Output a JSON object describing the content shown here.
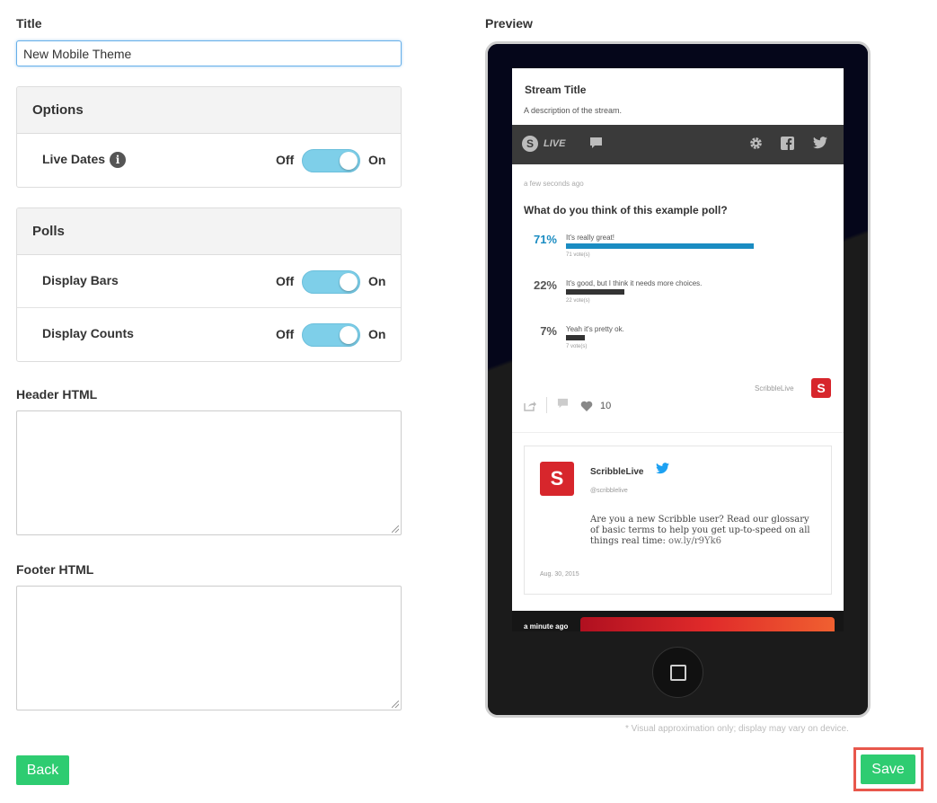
{
  "form": {
    "title_label": "Title",
    "title_value": "New Mobile Theme",
    "preview_label": "Preview",
    "options": {
      "heading": "Options",
      "rows": [
        {
          "label": "Live Dates",
          "off": "Off",
          "on": "On",
          "value": "on"
        }
      ]
    },
    "polls": {
      "heading": "Polls",
      "rows": [
        {
          "label": "Display Bars",
          "off": "Off",
          "on": "On",
          "value": "on"
        },
        {
          "label": "Display Counts",
          "off": "Off",
          "on": "On",
          "value": "on"
        }
      ]
    },
    "header_html_label": "Header HTML",
    "footer_html_label": "Footer HTML",
    "info_glyph": "i"
  },
  "buttons": {
    "back": "Back",
    "save": "Save"
  },
  "preview": {
    "stream_title": "Stream Title",
    "stream_desc": "A description of the stream.",
    "bar": {
      "logo": "S",
      "live": "LIVE"
    },
    "post": {
      "time": "a few seconds ago",
      "question": "What do you think of this example poll?",
      "options": [
        {
          "pct_label": "71%",
          "pct": 71,
          "label": "It's really great!",
          "votes": "71 vote(s)",
          "color": "#1a8cc2",
          "pct_color": "#1a8cc2"
        },
        {
          "pct_label": "22%",
          "pct": 22,
          "label": "It's good, but I think it needs more choices.",
          "votes": "22 vote(s)",
          "color": "#333333",
          "pct_color": "#555555"
        },
        {
          "pct_label": "7%",
          "pct": 7,
          "label": "Yeah it's pretty ok.",
          "votes": "7 vote(s)",
          "color": "#333333",
          "pct_color": "#555555"
        }
      ],
      "brand": "ScribbleLive",
      "brand_logo": "S",
      "likes": "10"
    },
    "tweet": {
      "logo": "S",
      "name": "ScribbleLive",
      "handle": "@scribblelive",
      "text": "Are you a new Scribble user? Read our glossary of basic terms to help you get up-to-speed on all things real time:",
      "link": "ow.ly/r9Yk6",
      "date": "Aug. 30, 2015"
    },
    "next_time": "a minute ago"
  },
  "disclaimer": "* Visual approximation only; display may vary on device.",
  "colors": {
    "accent_green": "#2ecc71",
    "switch_on": "#7ecfe9",
    "save_highlight": "#e8574c"
  }
}
